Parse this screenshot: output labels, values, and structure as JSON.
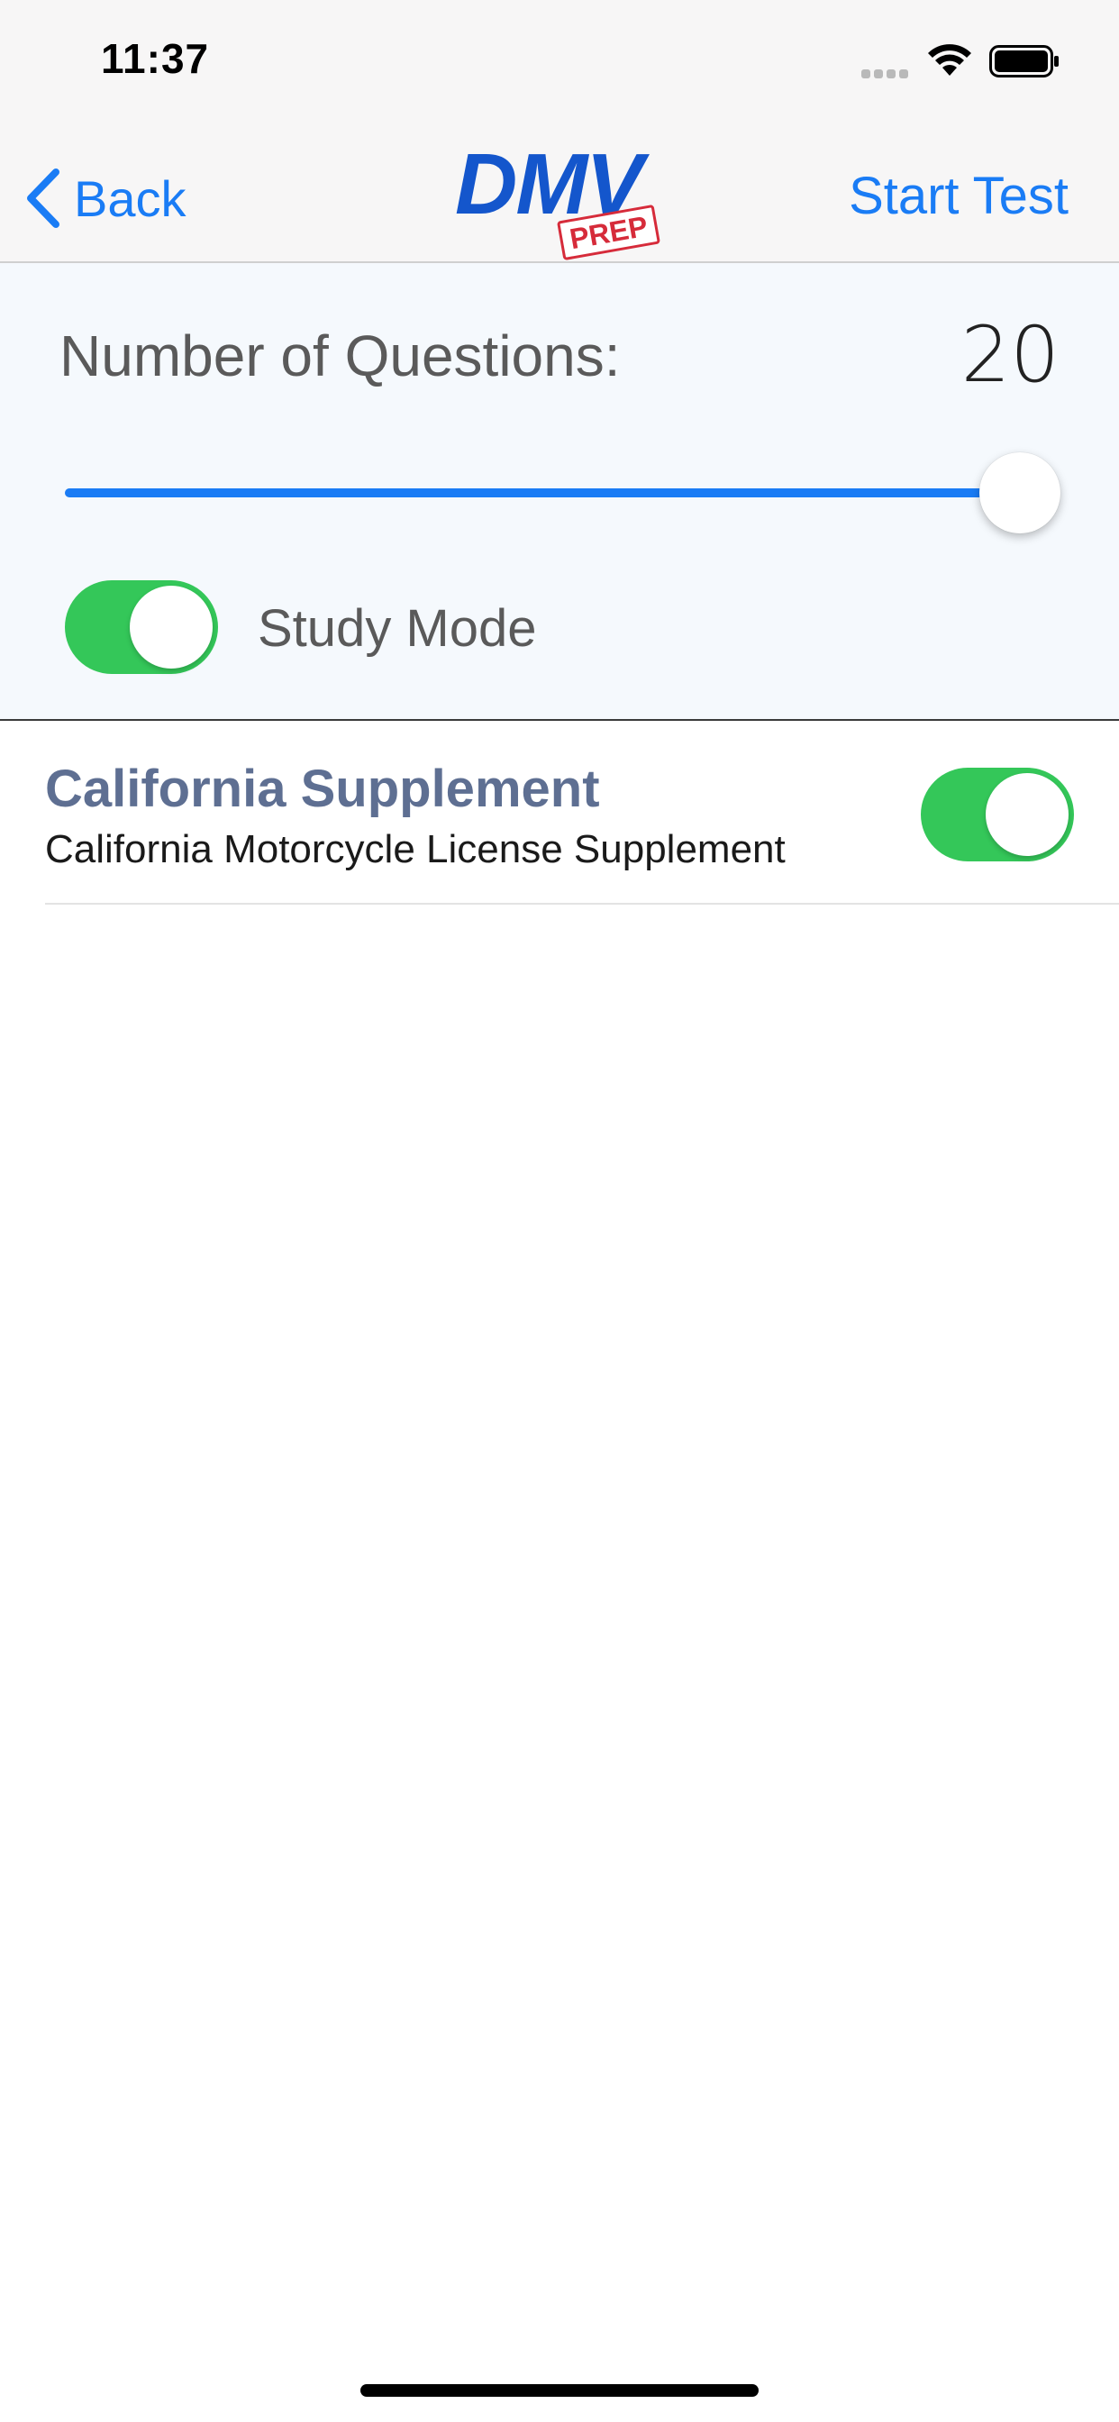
{
  "status_bar": {
    "time": "11:37",
    "signal_icon": "cellular-signal-icon",
    "wifi_icon": "wifi-icon",
    "battery_icon": "battery-icon"
  },
  "nav": {
    "back_label": "Back",
    "back_icon": "chevron-left-icon",
    "logo_text": "DMV",
    "logo_badge": "PREP",
    "start_test_label": "Start Test"
  },
  "settings": {
    "questions_label": "Number of Questions:",
    "questions_value": "20",
    "slider_fraction": 1.0,
    "study_mode_label": "Study Mode",
    "study_mode_on": true
  },
  "supplements": [
    {
      "title": "California Supplement",
      "subtitle": "California Motorcycle License Supplement",
      "enabled": true
    }
  ],
  "colors": {
    "accent": "#1a7cf5",
    "toggle_on": "#34c759",
    "logo_blue": "#1456cc",
    "logo_red": "#d62b3a",
    "supplement_title": "#5e6f92"
  }
}
